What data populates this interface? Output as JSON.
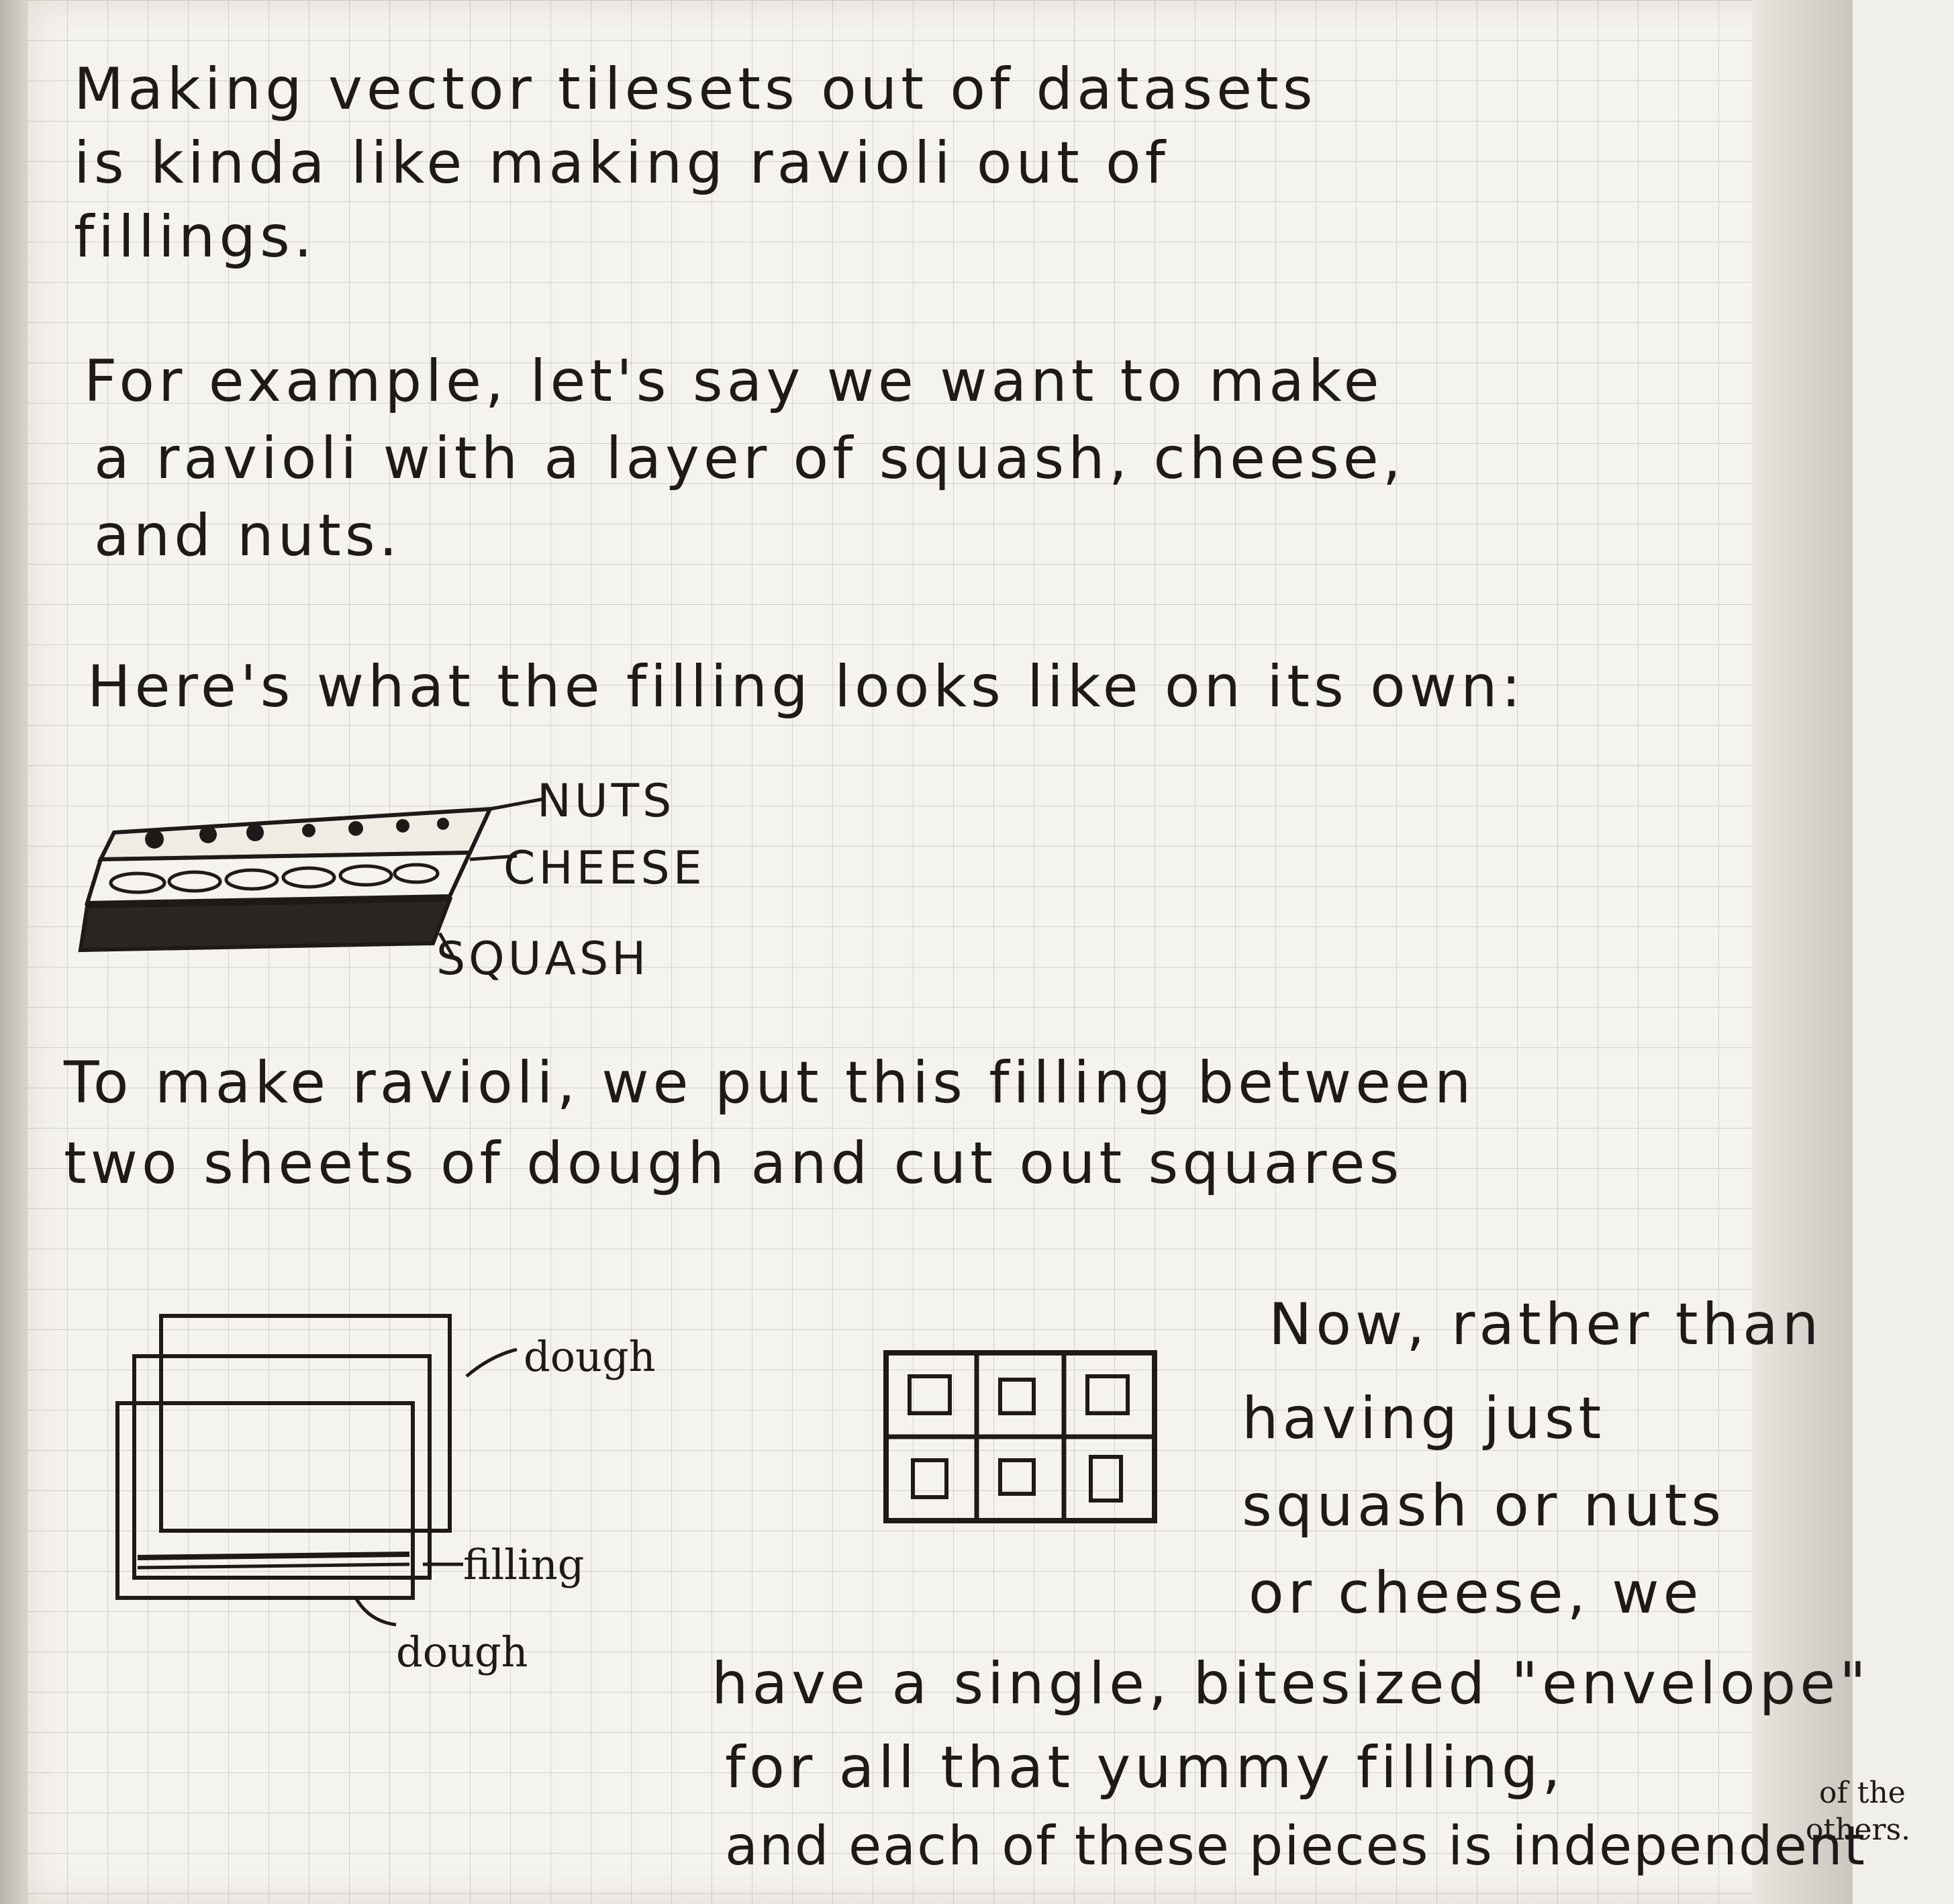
{
  "intro": {
    "line1": "Making vector tilesets out of datasets",
    "line2": "is kinda like making ravioli out of",
    "line3": "fillings."
  },
  "example": {
    "line1": "For example, let's say we want to make",
    "line2": "a ravioli with a layer of squash, cheese,",
    "line3": "and nuts."
  },
  "filling_intro": "Here's what the filling looks like on its own:",
  "layers_diagram": {
    "nuts_label": "NUTS",
    "cheese_label": "CHEESE",
    "squash_label": "SQUASH"
  },
  "ravioli_step": {
    "line1": "To make ravioli, we put this filling between",
    "line2": "two sheets of dough and cut out squares"
  },
  "sheets_diagram": {
    "top_label": "dough",
    "middle_label": "filling",
    "bottom_label": "dough"
  },
  "conclusion": {
    "line1": "Now, rather than",
    "line2": "having just",
    "line3": "squash or nuts",
    "line4": "or cheese, we",
    "line5": "have a single, bitesized \"envelope\"",
    "line6": "for all that yummy filling,",
    "line7": "and each of these pieces is independent",
    "line7_note_top": "of the",
    "line7_note_bottom": "others."
  }
}
